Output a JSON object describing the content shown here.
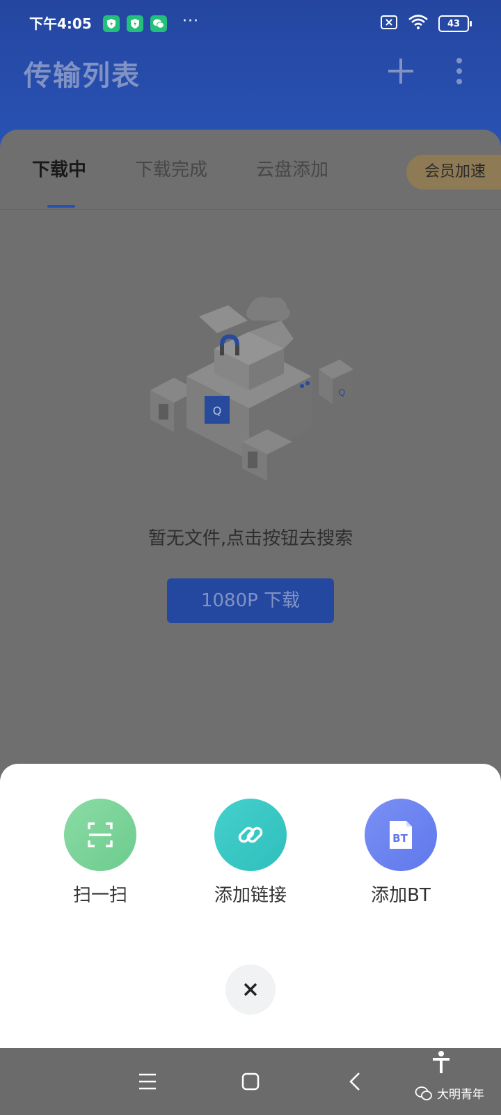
{
  "status_bar": {
    "time": "下午4:05",
    "dots": "···",
    "battery": "43"
  },
  "header": {
    "title": "传输列表"
  },
  "tabs": [
    {
      "label": "下载中",
      "active": true
    },
    {
      "label": "下载完成",
      "active": false
    },
    {
      "label": "云盘添加",
      "active": false
    }
  ],
  "vip_button": "会员加速",
  "empty_state": {
    "message": "暂无文件,点击按钮去搜索",
    "button_label": "1080P 下载"
  },
  "sheet": {
    "actions": [
      {
        "label": "扫一扫",
        "icon": "scan-icon",
        "color": "#7ed49a"
      },
      {
        "label": "添加链接",
        "icon": "link-icon",
        "color": "#3ec9c6"
      },
      {
        "label": "添加BT",
        "icon": "bt-file-icon",
        "color": "#6b83f0"
      }
    ],
    "bt_glyph": "BT",
    "close": "close-icon"
  },
  "watermark": "大明青年",
  "colors": {
    "header": "#2446a0",
    "accent": "#2550b4",
    "vip": "#8e7a55"
  }
}
